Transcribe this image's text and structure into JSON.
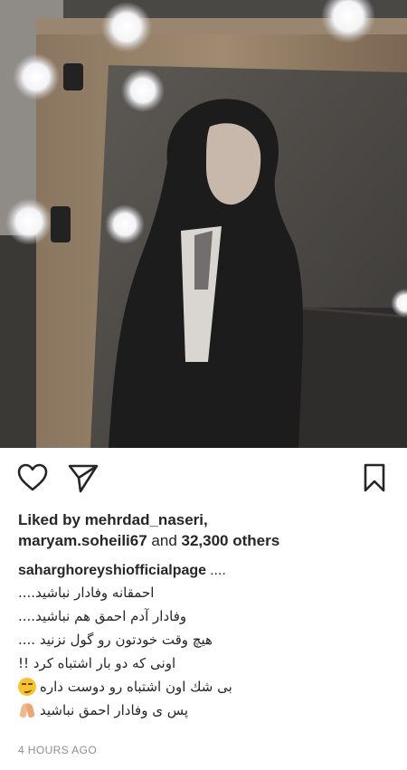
{
  "post": {
    "photo": {
      "description_icon": "post-photo"
    },
    "actions": {
      "like_icon": "heart-icon",
      "share_icon": "paper-plane-icon",
      "save_icon": "bookmark-icon"
    },
    "likes": {
      "prefix": "Liked by ",
      "user1": "mehrdad_naseri,",
      "user2": "maryam.soheili67",
      "middle": " and ",
      "count": "32,300 others"
    },
    "caption": {
      "username": "saharghoreyshiofficialpage",
      "dots": "....",
      "lines": [
        "احمقانه وفادار نباشید....",
        "وفادار آدم احمق هم نباشید....",
        "هیچ وقت خودتون رو گول نزنید ....",
        "اونی که دو بار اشتباه کرد !!",
        "بی شك اون اشتباه رو دوست داره",
        "پس ی  وفادار احمق نباشید"
      ],
      "emoji_5": "smirk-emoji",
      "emoji_6": "pray-emoji"
    },
    "timestamp": "4 HOURS AGO"
  }
}
